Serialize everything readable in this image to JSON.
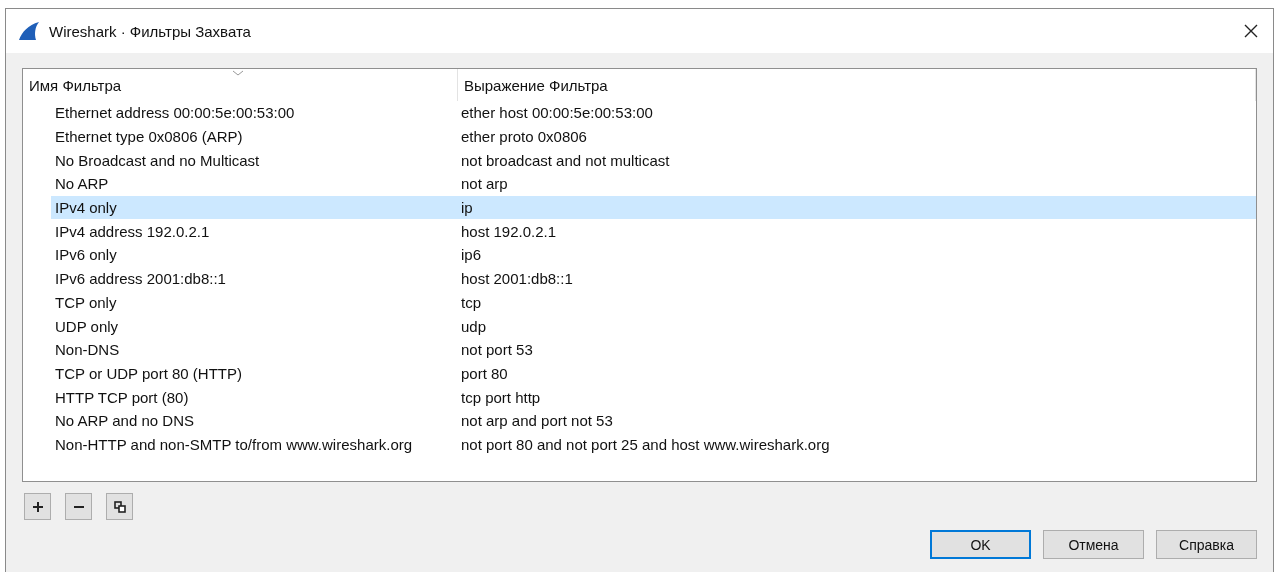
{
  "window": {
    "title": "Wireshark · Фильтры Захвата"
  },
  "table": {
    "columns": [
      {
        "label": "Имя Фильтра",
        "sorted": true
      },
      {
        "label": "Выражение Фильтра",
        "sorted": false
      }
    ],
    "rows": [
      {
        "name": "Ethernet address 00:00:5e:00:53:00",
        "expression": "ether host 00:00:5e:00:53:00",
        "selected": false
      },
      {
        "name": "Ethernet type 0x0806 (ARP)",
        "expression": "ether proto 0x0806",
        "selected": false
      },
      {
        "name": "No Broadcast and no Multicast",
        "expression": "not broadcast and not multicast",
        "selected": false
      },
      {
        "name": "No ARP",
        "expression": "not arp",
        "selected": false
      },
      {
        "name": "IPv4 only",
        "expression": "ip",
        "selected": true
      },
      {
        "name": "IPv4 address 192.0.2.1",
        "expression": "host 192.0.2.1",
        "selected": false
      },
      {
        "name": "IPv6 only",
        "expression": "ip6",
        "selected": false
      },
      {
        "name": "IPv6 address 2001:db8::1",
        "expression": "host 2001:db8::1",
        "selected": false
      },
      {
        "name": "TCP only",
        "expression": "tcp",
        "selected": false
      },
      {
        "name": "UDP only",
        "expression": "udp",
        "selected": false
      },
      {
        "name": "Non-DNS",
        "expression": "not port 53",
        "selected": false
      },
      {
        "name": "TCP or UDP port 80 (HTTP)",
        "expression": "port 80",
        "selected": false
      },
      {
        "name": "HTTP TCP port (80)",
        "expression": "tcp port http",
        "selected": false
      },
      {
        "name": "No ARP and no DNS",
        "expression": "not arp and port not 53",
        "selected": false
      },
      {
        "name": "Non-HTTP and non-SMTP to/from www.wireshark.org",
        "expression": "not port 80 and not port 25 and host www.wireshark.org",
        "selected": false
      }
    ]
  },
  "tool_buttons": [
    {
      "kind": "add"
    },
    {
      "kind": "remove"
    },
    {
      "kind": "copy"
    }
  ],
  "buttons": [
    {
      "label": "OK",
      "default": true
    },
    {
      "label": "Отмена",
      "default": false
    },
    {
      "label": "Справка",
      "default": false
    }
  ]
}
